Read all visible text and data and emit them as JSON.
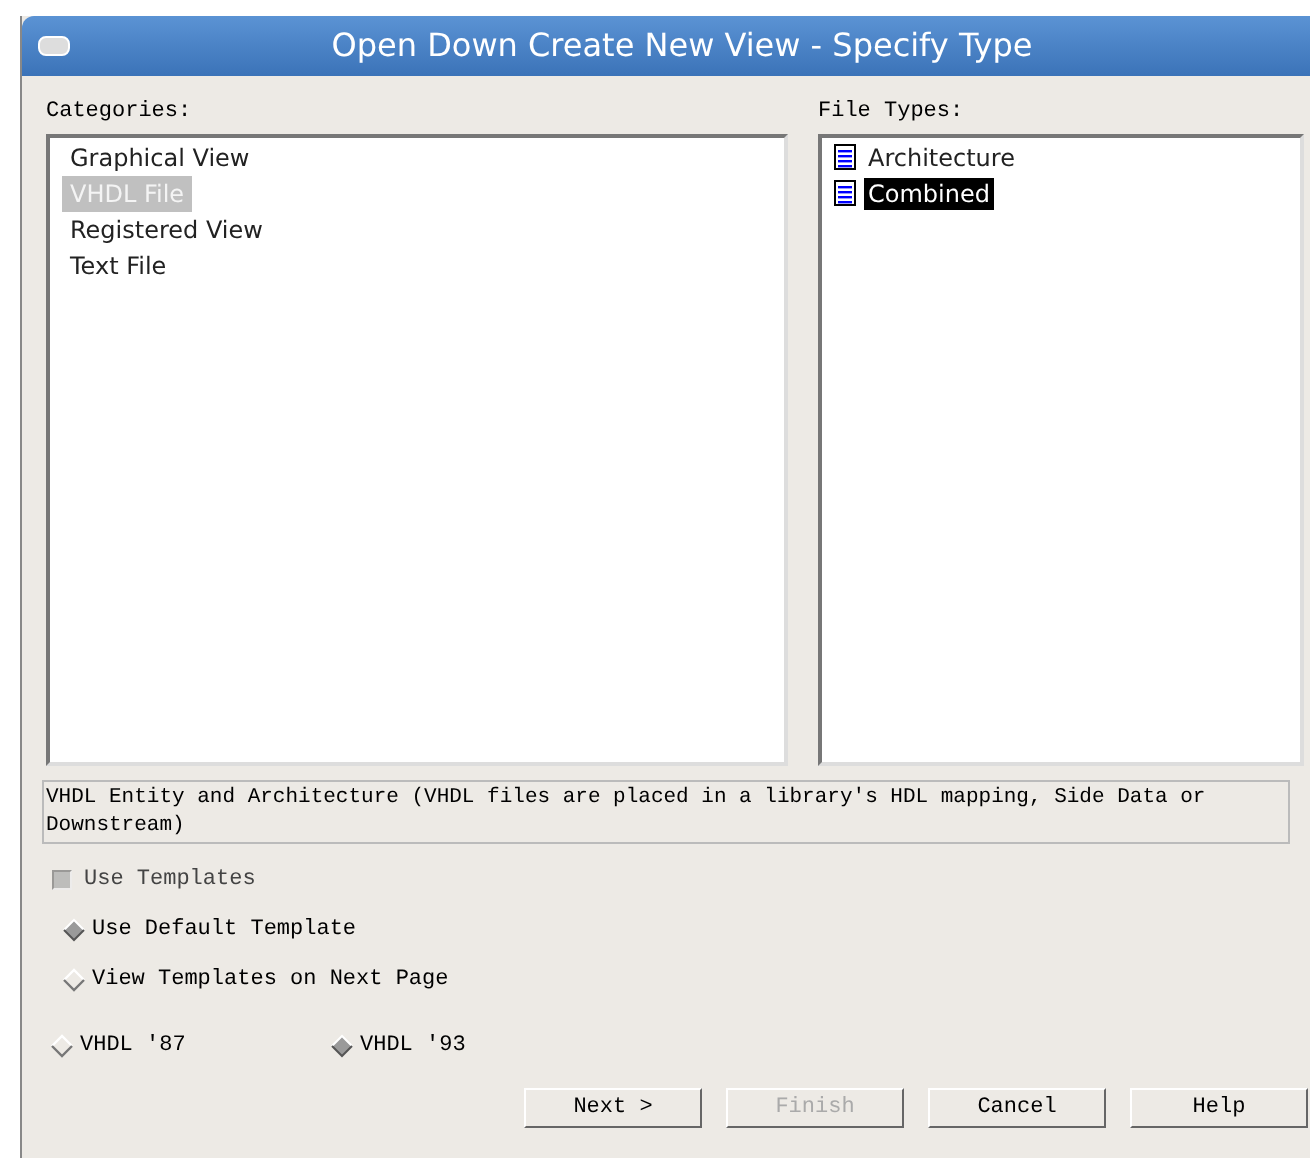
{
  "window": {
    "title": "Open Down Create New View - Specify Type"
  },
  "categories": {
    "label": "Categories:",
    "items": [
      {
        "label": "Graphical View",
        "selected": false
      },
      {
        "label": "VHDL File",
        "selected": true
      },
      {
        "label": "Registered View",
        "selected": false
      },
      {
        "label": "Text File",
        "selected": false
      }
    ]
  },
  "file_types": {
    "label": "File Types:",
    "items": [
      {
        "label": "Architecture",
        "selected": false
      },
      {
        "label": "Combined",
        "selected": true
      }
    ]
  },
  "description": "VHDL Entity and Architecture (VHDL files are placed in a library's HDL mapping, Side Data or Downstream)",
  "use_templates": {
    "label": "Use Templates",
    "checked": true,
    "disabled": true
  },
  "template_options": [
    {
      "label": "Use Default Template",
      "selected": true
    },
    {
      "label": "View Templates on Next Page",
      "selected": false
    }
  ],
  "vhdl_versions": [
    {
      "label": "VHDL '87",
      "selected": false
    },
    {
      "label": "VHDL '93",
      "selected": true
    }
  ],
  "buttons": [
    {
      "label": "Next >",
      "disabled": false
    },
    {
      "label": "Finish",
      "disabled": true
    },
    {
      "label": "Cancel",
      "disabled": false
    },
    {
      "label": "Help",
      "disabled": false
    }
  ]
}
